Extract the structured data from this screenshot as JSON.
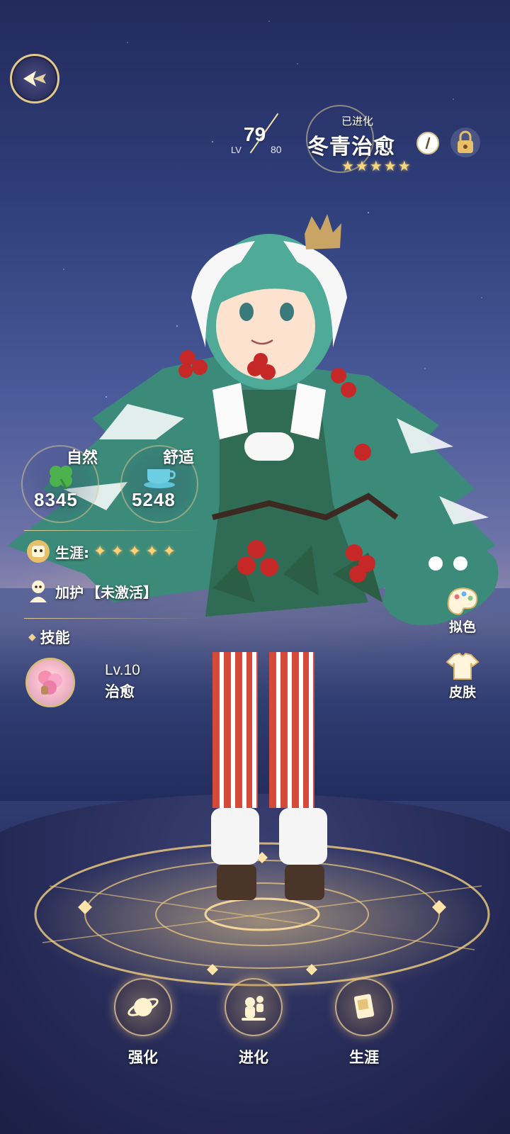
{
  "header": {
    "level_current": "79",
    "level_label": "LV",
    "level_max": "80",
    "evolved_tag": "已进化",
    "character_name": "冬青治愈",
    "rarity_stars": 5
  },
  "stats": {
    "nature": {
      "label": "自然",
      "value": "8345"
    },
    "comfort": {
      "label": "舒适",
      "value": "5248"
    }
  },
  "info": {
    "career_label": "生涯:",
    "career_stars": 5,
    "guard_label": "加护",
    "guard_value": "【未激活】"
  },
  "skill": {
    "section_title": "技能",
    "level": "Lv.10",
    "name": "治愈"
  },
  "side_actions": {
    "dye_label": "拟色",
    "skin_label": "皮肤"
  },
  "bottom_nav": {
    "enhance_label": "强化",
    "evolve_label": "进化",
    "career_label": "生涯"
  },
  "colors": {
    "accent_gold": "#e2c98a",
    "star_gold": "#f5d780",
    "sky_top": "#232a5c"
  },
  "icons": {
    "back": "back-arrow-icon",
    "info": "info-icon",
    "lock": "lock-icon",
    "nature": "clover-icon",
    "comfort": "teacup-icon",
    "career": "cat-badge-icon",
    "guard": "guard-badge-icon",
    "skill": "healing-skill-icon",
    "dye": "palette-icon",
    "skin": "shirt-icon",
    "enhance": "planet-icon",
    "evolve": "evolve-icon",
    "career_nav": "book-icon"
  }
}
